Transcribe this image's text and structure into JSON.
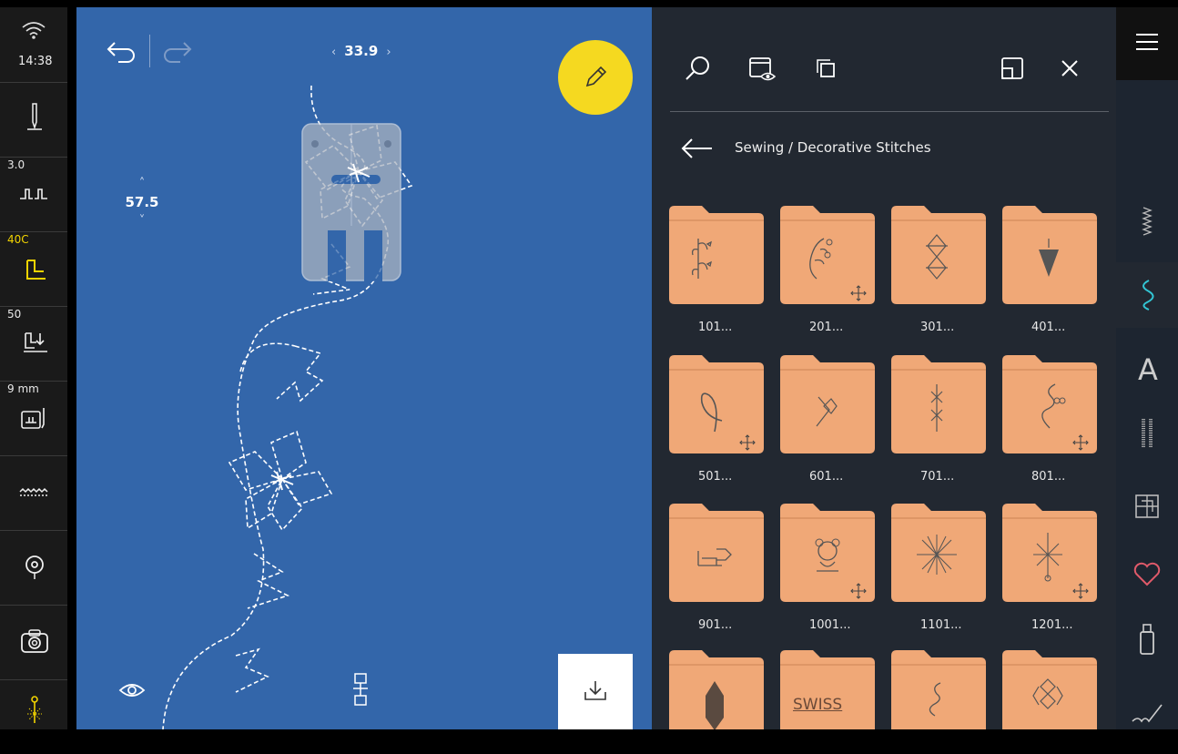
{
  "status": {
    "time": "14:38"
  },
  "left_bar": {
    "stitch_width": "3.0",
    "tension": "40C",
    "presser_pressure": "50",
    "foot_height": "9 mm"
  },
  "canvas": {
    "length_value": "33.9",
    "width_value": "57.5"
  },
  "panel": {
    "breadcrumb": "Sewing / Decorative Stitches",
    "folders": [
      {
        "label": "101..."
      },
      {
        "label": "201..."
      },
      {
        "label": "301..."
      },
      {
        "label": "401..."
      },
      {
        "label": "501..."
      },
      {
        "label": "601..."
      },
      {
        "label": "701..."
      },
      {
        "label": "801..."
      },
      {
        "label": "901..."
      },
      {
        "label": "1001..."
      },
      {
        "label": "1101..."
      },
      {
        "label": "1201..."
      }
    ],
    "swiss_text": "SWISS"
  },
  "colors": {
    "canvas": "#3366aa",
    "panel": "#222831",
    "folder": "#f0a877",
    "accent_yellow": "#f5d920",
    "selected_stitch": "#32c6d4",
    "favorite": "#e05a6a"
  },
  "icons": {
    "left_bar": [
      "wifi-icon",
      "needle-icon",
      "stitch-width-icon",
      "thread-tension-icon",
      "presser-foot-pressure-icon",
      "presser-foot-height-icon",
      "feed-dog-icon",
      "bobbin-icon",
      "camera-icon",
      "needle-stop-icon"
    ],
    "canvas": [
      "undo-icon",
      "redo-icon",
      "edit-pencil-icon",
      "eye-icon",
      "pattern-start-icon",
      "download-icon"
    ],
    "panel": [
      "search-icon",
      "preview-icon",
      "duplicate-icon",
      "window-icon",
      "close-icon",
      "back-arrow-icon",
      "move-icon"
    ],
    "right_strip": [
      "menu-icon",
      "utility-stitches-icon",
      "decorative-stitches-icon",
      "alphabets-icon",
      "buttonholes-icon",
      "quilt-stitches-icon",
      "favorites-heart-icon",
      "usb-stick-icon",
      "embroidery-icon"
    ]
  }
}
